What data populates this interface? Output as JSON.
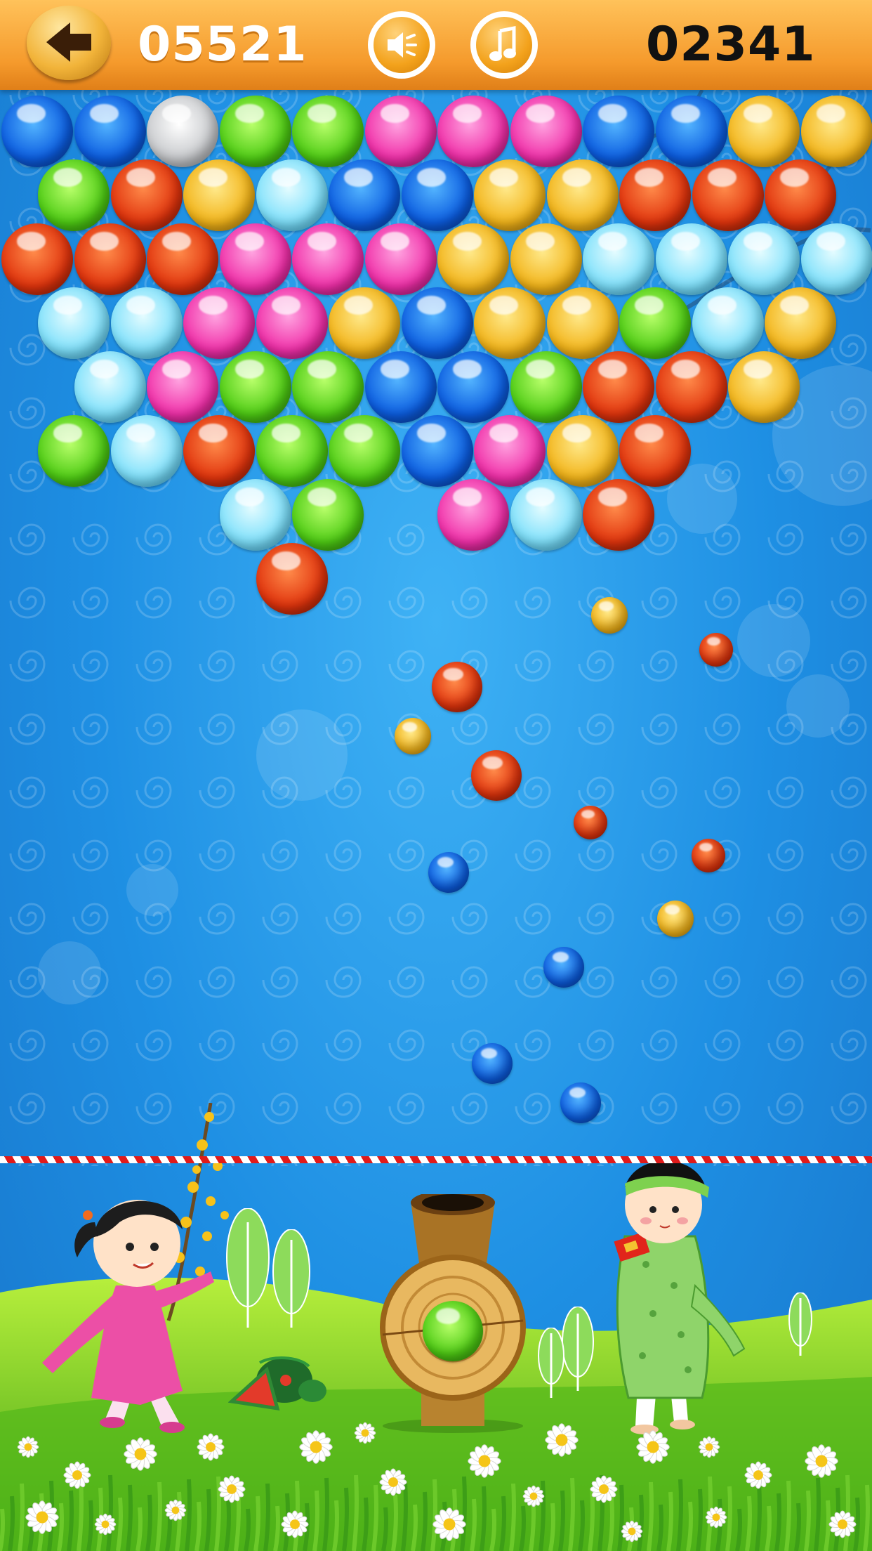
{
  "hud": {
    "score_left": "05521",
    "score_right": "02341",
    "back_icon": "back-arrow-icon",
    "sound_icon": "speaker-icon",
    "music_icon": "music-note-icon"
  },
  "colors": {
    "bar_top": "#ffc25a",
    "bar_bottom": "#e07f18",
    "sky": "#1e8fe3",
    "grass": "#8edc2a"
  },
  "bubble_grid": {
    "rows": [
      [
        "blue",
        "blue",
        "silver",
        "green",
        "green",
        "pink",
        "pink",
        "pink",
        "blue",
        "blue",
        "yellow",
        "yellow"
      ],
      [
        "green",
        "red",
        "yellow",
        "cyan",
        "blue",
        "blue",
        "yellow",
        "yellow",
        "red",
        "red",
        "red"
      ],
      [
        "red",
        "red",
        "red",
        "pink",
        "pink",
        "pink",
        "yellow",
        "yellow",
        "cyan",
        "cyan",
        "cyan",
        "cyan"
      ],
      [
        "cyan",
        "cyan",
        "pink",
        "pink",
        "yellow",
        "blue",
        "yellow",
        "yellow",
        "green",
        "cyan",
        "yellow"
      ],
      [
        null,
        "cyan",
        "pink",
        "green",
        "green",
        "blue",
        "blue",
        "green",
        "red",
        "red",
        "yellow"
      ],
      [
        "green",
        "cyan",
        "red",
        "green",
        "green",
        "blue",
        "pink",
        "yellow",
        "red"
      ],
      [
        null,
        null,
        null,
        "cyan",
        "green",
        null,
        "pink",
        "cyan",
        "red"
      ],
      [
        null,
        null,
        null,
        "red"
      ]
    ]
  },
  "falling_balls": [
    {
      "color": "yellow"
    },
    {
      "color": "red"
    },
    {
      "color": "red"
    },
    {
      "color": "yellow"
    },
    {
      "color": "red"
    },
    {
      "color": "red"
    },
    {
      "color": "red"
    },
    {
      "color": "blue"
    },
    {
      "color": "yellow"
    },
    {
      "color": "blue"
    },
    {
      "color": "blue"
    },
    {
      "color": "blue"
    }
  ],
  "shooter": {
    "loaded_bubble": "green"
  }
}
